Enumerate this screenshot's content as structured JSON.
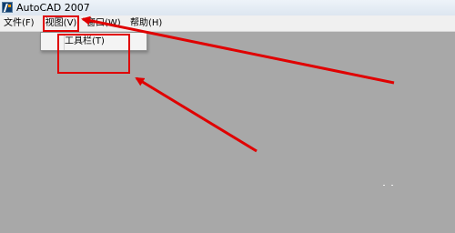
{
  "window": {
    "title": "AutoCAD 2007",
    "icon": "autocad-app-icon"
  },
  "menubar": {
    "items": [
      {
        "label": "文件(F)"
      },
      {
        "label": "视图(V)"
      },
      {
        "label": "窗口(W)"
      },
      {
        "label": "帮助(H)"
      }
    ]
  },
  "dropdown": {
    "items": [
      {
        "label": "工具栏(T)"
      }
    ]
  },
  "annotations": {
    "color": "#e00000"
  }
}
